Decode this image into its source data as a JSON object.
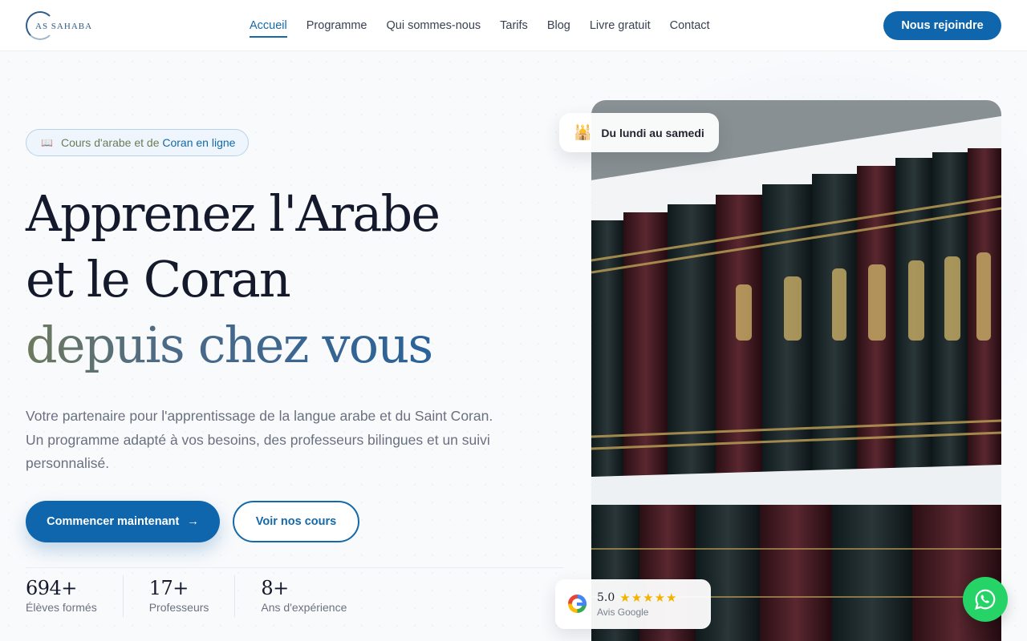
{
  "header": {
    "logo_text": "AS SAHABA",
    "nav": [
      {
        "label": "Accueil",
        "active": true
      },
      {
        "label": "Programme"
      },
      {
        "label": "Qui sommes-nous"
      },
      {
        "label": "Tarifs"
      },
      {
        "label": "Blog"
      },
      {
        "label": "Livre gratuit"
      },
      {
        "label": "Contact"
      }
    ],
    "cta_label": "Nous rejoindre"
  },
  "hero": {
    "badge": {
      "icon": "book-icon",
      "part1": "Cours d'arabe",
      "part2": "et de",
      "part3": "Coran en ligne"
    },
    "title_line1": "Apprenez l'Arabe",
    "title_line2": "et le Coran",
    "title_line3": "depuis chez vous",
    "description": "Votre partenaire pour l'apprentissage de la langue arabe et du Saint Coran. Un programme adapté à vos besoins, des professeurs bilingues et un suivi personnalisé.",
    "primary_button": "Commencer maintenant",
    "primary_arrow": "→",
    "secondary_button": "Voir nos cours"
  },
  "stats": [
    {
      "value": "694+",
      "label": "Élèves formés"
    },
    {
      "value": "17+",
      "label": "Professeurs"
    },
    {
      "value": "8+",
      "label": "Ans d'expérience"
    }
  ],
  "schedule_card": {
    "icon": "mosque-icon",
    "text": "Du lundi au samedi"
  },
  "review_card": {
    "icon": "google-icon",
    "score": "5.0",
    "stars": "★★★★★",
    "label": "Avis Google"
  },
  "colors": {
    "primary": "#0f66ac",
    "title": "#141a2c",
    "whatsapp": "#25d366",
    "stars": "#f2b300"
  }
}
